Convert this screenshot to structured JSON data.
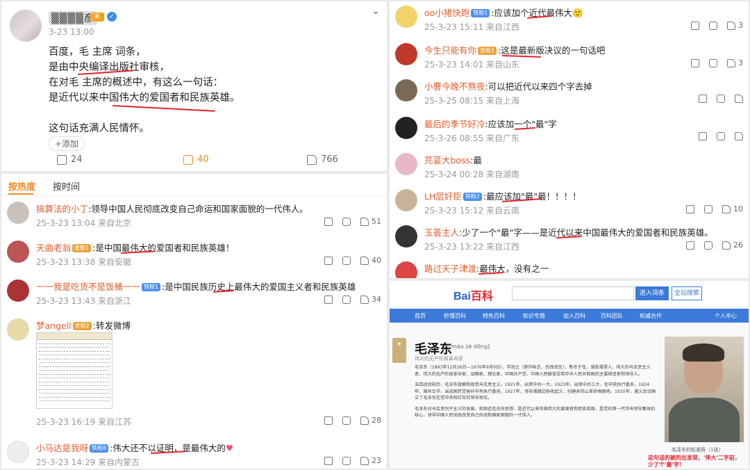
{
  "post": {
    "username": "▒▒▒▒彦",
    "vip_badge": "Ⅲ",
    "time": "3-23 13:00",
    "lines": [
      "百度，毛 主席 词条，",
      "是由中央编译出版社审核，",
      "在对毛 主席的概述中，有这么一句话：",
      "是近代以来中国伟大的爱国者和民族英雄。",
      "",
      "这句话充满人民情怀。"
    ],
    "add_tag": "+添加",
    "share_count": "24",
    "comment_count": "40",
    "like_count": "766"
  },
  "left_tabs": {
    "hot": "按热度",
    "time": "按时间"
  },
  "left_comments": [
    {
      "user": "搞算法的小丁",
      "badge": "",
      "text": ":领导中国人民彻底改变自己命运和国家面貌的一代伟人。",
      "meta": "25-3-23 13:04 来自北京",
      "likes": "51"
    },
    {
      "user": "天曲老翁",
      "badge": "金粉1",
      "text": ":是中国最伟大的爱国者和民族英雄！",
      "meta": "25-3-23 13:38 来自安徽",
      "likes": "40"
    },
    {
      "user": "一一我是吃货不是饭桶一一",
      "badge": "铁粉1",
      "text": ":是中国民族历史上最伟大的爱国主义者和民族英雄",
      "meta": "25-3-23 13:43 来自浙江",
      "likes": "34"
    },
    {
      "user": "梦angell",
      "badge": "金粉2",
      "text": ":转发微博",
      "meta": "25-3-23 16:19 来自江苏",
      "likes": "28"
    },
    {
      "user": "小马达是我呀",
      "badge": "铁粉8",
      "text": ":伟大还不以证明，是最伟大的",
      "meta": "25-3-23 14:29 来自内蒙古",
      "likes": "23"
    }
  ],
  "right_comments": [
    {
      "user": "oo小猪快跑",
      "badge": "铁粉1",
      "text": ":应该加个近代最伟大",
      "meta": "25-3-23 15:11 来自江西",
      "likes": "3"
    },
    {
      "user": "今生只能有你",
      "badge": "金粉1",
      "text": ":这是最新版决议的一句话吧",
      "meta": "25-3-23 14:01 来自山东",
      "likes": "3"
    },
    {
      "user": "小曹今晚不熬夜",
      "badge": "",
      "text": ":可以把近代以来四个字去掉",
      "meta": "25-3-25 08:15 来自上海",
      "likes": ""
    },
    {
      "user": "最后的季节好冷",
      "badge": "",
      "text": ":应该加一个\"最\"字",
      "meta": "25-3-26 08:55 来自广东",
      "likes": ""
    },
    {
      "user": "芫荽大boss",
      "badge": "",
      "text": ":最",
      "meta": "25-3-24 00:28 来自湖南",
      "likes": ""
    },
    {
      "user": "LH层奸臣",
      "badge": "铁粉2",
      "text": ":最应该加\"最\"最！！！！",
      "meta": "25-3-23 15:12 来自云南",
      "likes": "10"
    },
    {
      "user": "玉荟主人",
      "badge": "",
      "text": ":少了一个\"最\"字——是近代以来中国最伟大的爱国者和民族英雄。",
      "meta": "25-3-23 13:22 来自江西",
      "likes": "26"
    },
    {
      "user": "路过天子津渡",
      "badge": "",
      "text": ":最伟大，没有之一",
      "meta": "",
      "likes": ""
    }
  ],
  "baike": {
    "logo_a": "Bai",
    "logo_b": "百科",
    "enter_btn": "进入词条",
    "global_btn": "全站搜索",
    "nav": [
      "首页",
      "秒懂百科",
      "特色百科",
      "知识专题",
      "加入百科",
      "百科团队",
      "权威合作",
      "个人中心"
    ],
    "title": "毛泽东",
    "pinyin": "[máo zé dōng]",
    "subtitle": "伟大的无产阶级革命家",
    "paragraphs": [
      "毛泽东（1893年12月26日—1976年9月9日），字润之（原作咏芝，后改润芝），笔名子任。湖南湘潭人。伟大的马克思主义者，伟大的无产阶级革命家、战略家、理论家，中国共产党、中国人民解放军和中华人民共和国的主要缔造者和领导人。",
      "五四运动前后，毛泽东接触和接受马克思主义。1921年，出席中共一大。1923年，出席中共三大，任中央执行委员。1924年，国共合作，当选国民党候补中央执行委员。1927年，领导湘赣边秋收起义，创建井冈山革命根据地。1935年，遵义会议确立了毛泽东在党中央和红军的领导地位。",
      "毛泽东对马克思列宁主义的发展，和缔造毛泽东思想，是近代以来中国伟大的爱国者和民族英雄，是党的第一代中央领导集体的核心，领导中国人民彻底改变自己命运和国家面貌的一代伟人。"
    ],
    "photo_caption": "毛泽东的标准照（1张）",
    "note": "这句话的被的出发现，'伟大'二字前，少了个'最'字！"
  },
  "colors": {
    "accent": "#f08a24",
    "username": "#e35d2b",
    "redline": "#e3242b",
    "baidu_blue": "#3b7ad8"
  }
}
